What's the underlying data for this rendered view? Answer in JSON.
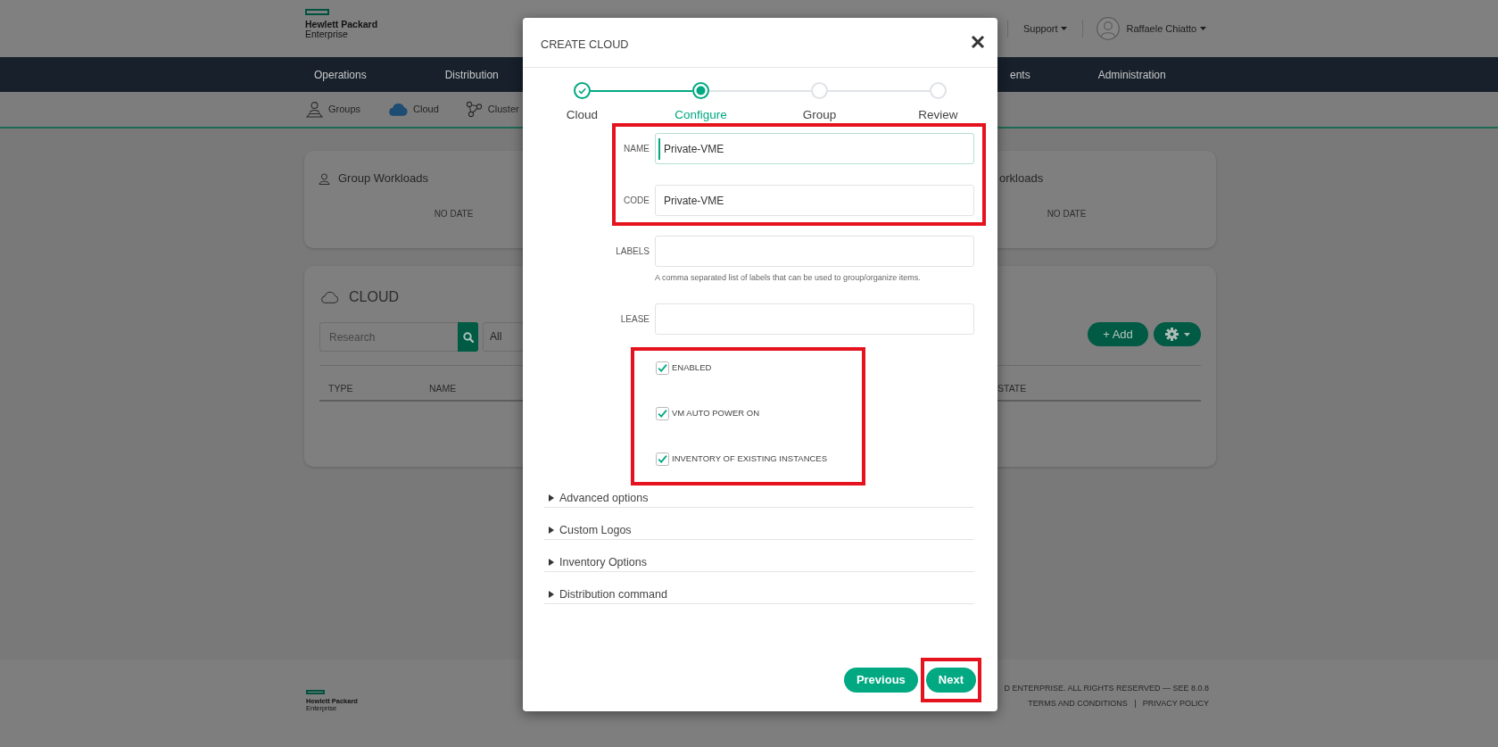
{
  "header": {
    "logo": [
      "Hewlett Packard",
      "Enterprise"
    ],
    "support_menu": "Support",
    "user_name": "Raffaele Chiatto"
  },
  "main_nav": [
    "Operations",
    "Distribution",
    "ents",
    "Administration"
  ],
  "sub_nav": [
    {
      "label": "Groups",
      "selected": false
    },
    {
      "label": "Cloud",
      "selected": true
    },
    {
      "label": "Cluster",
      "selected": false
    }
  ],
  "widgets": [
    {
      "title": "Group Workloads",
      "message": "NO DATE"
    },
    {
      "title": "orkloads",
      "message": "NO DATE"
    }
  ],
  "cloud_panel": {
    "title": "CLOUD",
    "search": {
      "placeholder": "Research"
    },
    "filter": {
      "value": "All"
    },
    "add_button": "+ Add",
    "table": {
      "columns": [
        "TYPE",
        "NAME",
        "STATE"
      ]
    }
  },
  "footer": {
    "logo": [
      "Hewlett Packard",
      "Enterprise"
    ],
    "copyright": "D ENTERPRISE. ALL RIGHTS RESERVED — SEE 8.0.8",
    "links": [
      "TERMS AND CONDITIONS",
      "PRIVACY POLICY"
    ]
  },
  "modal": {
    "title": "CREATE CLOUD",
    "steps": [
      {
        "label": "Cloud",
        "done": true,
        "selected": false
      },
      {
        "label": "Configure",
        "done": false,
        "selected": true
      },
      {
        "label": "Group",
        "done": false,
        "selected": false
      },
      {
        "label": "Review",
        "done": false,
        "selected": false
      }
    ],
    "field_groups": [
      {
        "highlighted": true,
        "fields": [
          {
            "label": "NAME",
            "value": "Private-VME",
            "focused": true
          },
          {
            "label": "CODE",
            "value": "Private-VME",
            "focused": false
          }
        ]
      },
      {
        "highlighted": false,
        "fields": [
          {
            "label": "LABELS",
            "focused": false,
            "help": "A comma separated list of labels that can be used to group/organize items."
          },
          {
            "label": "LEASE",
            "focused": false
          }
        ]
      }
    ],
    "options": {
      "highlighted": true,
      "checkboxes": [
        {
          "label": "ENABLED",
          "checked": true
        },
        {
          "label": "VM AUTO POWER ON",
          "checked": true
        },
        {
          "label": "INVENTORY OF EXISTING INSTANCES",
          "checked": true
        }
      ]
    },
    "sections": [
      {
        "label": "Advanced options",
        "expanded": false
      },
      {
        "label": "Custom Logos",
        "expanded": false
      },
      {
        "label": "Inventory Options",
        "expanded": false
      },
      {
        "label": "Distribution command",
        "expanded": false
      }
    ],
    "buttons": [
      {
        "label": "Previous",
        "highlighted": false
      },
      {
        "label": "Next",
        "highlighted": true
      }
    ]
  }
}
